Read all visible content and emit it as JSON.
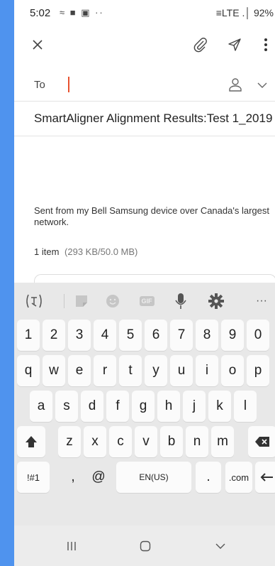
{
  "status_bar": {
    "time": "5:02",
    "notification_icons": "≈ ■ ▣ ··",
    "right_text": "≡LTE .│ 92%"
  },
  "toolbar": {
    "close_icon": "close-icon",
    "attach_icon": "paperclip-icon",
    "send_icon": "send-icon",
    "more_icon": "more-vertical-icon"
  },
  "compose": {
    "to_label": "To",
    "to_value": "",
    "subject": "SmartAligner Alignment Results:Test 1_2019",
    "signature": "Sent from my Bell Samsung device over Canada's largest network.",
    "attachments_count": "1 item",
    "attachments_size": "(293 KB/50.0 MB)"
  },
  "keyboard": {
    "toolbar_icons": [
      "translate-icon",
      "sticker-icon",
      "emoji-icon",
      "gif-icon",
      "mic-icon",
      "settings-icon",
      "more-icon"
    ],
    "gif_label": "GIF",
    "more_label": "···",
    "translate_label": "(T)",
    "row_numbers": [
      "1",
      "2",
      "3",
      "4",
      "5",
      "6",
      "7",
      "8",
      "9",
      "0"
    ],
    "row_top": [
      "q",
      "w",
      "e",
      "r",
      "t",
      "y",
      "u",
      "i",
      "o",
      "p"
    ],
    "row_middle": [
      "a",
      "s",
      "d",
      "f",
      "g",
      "h",
      "j",
      "k",
      "l"
    ],
    "row_bottom": [
      "z",
      "x",
      "c",
      "v",
      "b",
      "n",
      "m"
    ],
    "symbols_label": "!#1",
    "comma_label": ",",
    "at_label": "@",
    "space_label": "EN(US)",
    "period_label": ".",
    "dotcom_label": ".com"
  },
  "nav_bar": {
    "recents": "recents-icon",
    "home": "home-icon",
    "back": "back-icon"
  },
  "colors": {
    "background": "#4f93ee",
    "caret": "#e8522f",
    "keyboard_bg": "#e8e8e8"
  }
}
